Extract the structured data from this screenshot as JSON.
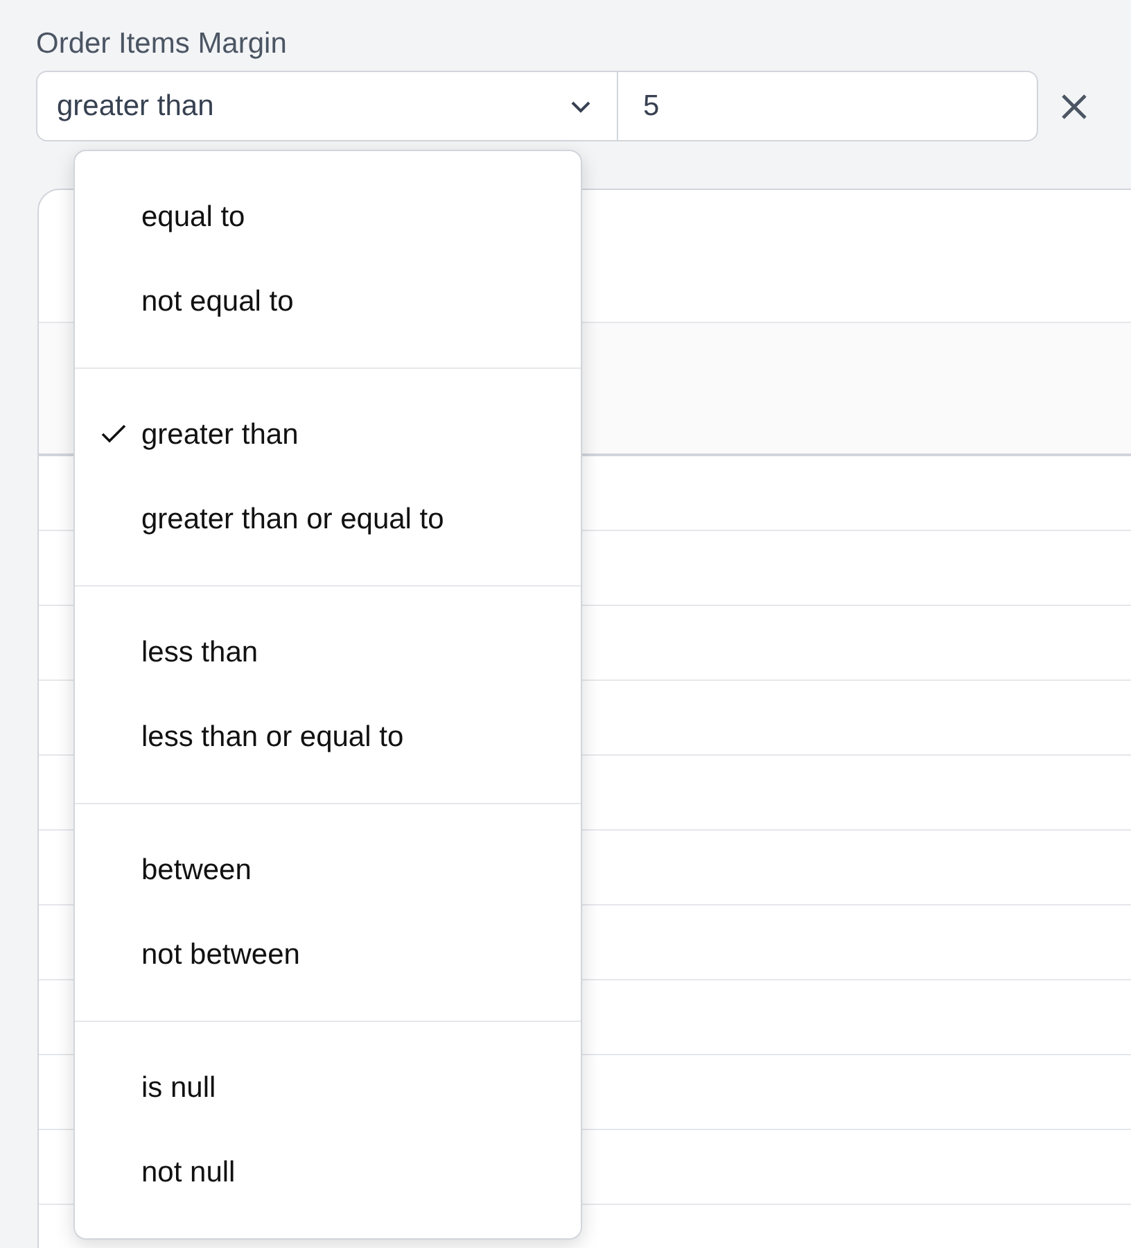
{
  "filter": {
    "label": "Order Items Margin",
    "operator": "greater than",
    "value": "5"
  },
  "operator_menu": {
    "groups": [
      {
        "options": [
          {
            "label": "equal to",
            "selected": false
          },
          {
            "label": "not equal to",
            "selected": false
          }
        ]
      },
      {
        "options": [
          {
            "label": "greater than",
            "selected": true
          },
          {
            "label": "greater than or equal to",
            "selected": false
          }
        ]
      },
      {
        "options": [
          {
            "label": "less than",
            "selected": false
          },
          {
            "label": "less than or equal to",
            "selected": false
          }
        ]
      },
      {
        "options": [
          {
            "label": "between",
            "selected": false
          },
          {
            "label": "not between",
            "selected": false
          }
        ]
      },
      {
        "options": [
          {
            "label": "is null",
            "selected": false
          },
          {
            "label": "not null",
            "selected": false
          }
        ]
      }
    ]
  }
}
